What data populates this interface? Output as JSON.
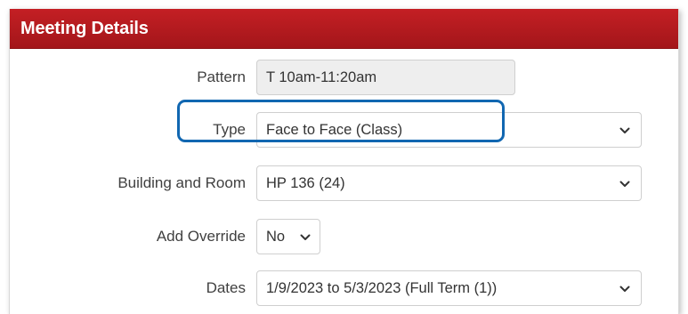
{
  "header": {
    "title": "Meeting Details"
  },
  "fields": {
    "pattern": {
      "label": "Pattern",
      "value": "T 10am-11:20am"
    },
    "type": {
      "label": "Type",
      "value": "Face to Face (Class)"
    },
    "building_room": {
      "label": "Building and Room",
      "value": "HP 136 (24)"
    },
    "add_override": {
      "label": "Add Override",
      "value": "No"
    },
    "dates": {
      "label": "Dates",
      "value": "1/9/2023 to 5/3/2023 (Full Term (1))"
    }
  },
  "colors": {
    "header_red": "#b31b1f",
    "highlight_blue": "#1167b1",
    "readonly_gray": "#eeeeee"
  },
  "icons": {
    "select_arrow": "chevron-down-icon"
  }
}
